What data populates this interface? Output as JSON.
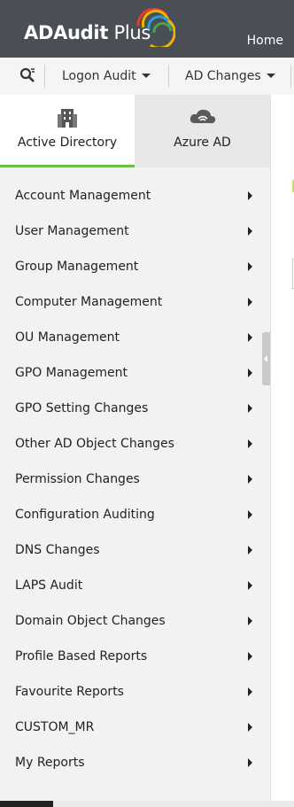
{
  "header": {
    "logo_text_bold": "ADAudit",
    "logo_text_light": "Plus",
    "home_label": "Home",
    "colors": {
      "background": "#4a4f55"
    }
  },
  "subnav": {
    "search_icon": "search-icon",
    "items": [
      {
        "label": "Logon Audit"
      },
      {
        "label": "AD Changes"
      }
    ]
  },
  "panel": {
    "tabs": [
      {
        "label": "Active Directory",
        "icon": "building-icon",
        "active": true
      },
      {
        "label": "Azure AD",
        "icon": "cloud-icon",
        "active": false
      }
    ],
    "menu": [
      {
        "label": "Account Management"
      },
      {
        "label": "User Management"
      },
      {
        "label": "Group Management"
      },
      {
        "label": "Computer Management"
      },
      {
        "label": "OU Management"
      },
      {
        "label": "GPO Management"
      },
      {
        "label": "GPO Setting Changes"
      },
      {
        "label": "Other AD Object Changes"
      },
      {
        "label": "Permission Changes"
      },
      {
        "label": "Configuration Auditing"
      },
      {
        "label": "DNS Changes"
      },
      {
        "label": "LAPS Audit"
      },
      {
        "label": "Domain Object Changes"
      },
      {
        "label": "Profile Based Reports"
      },
      {
        "label": "Favourite Reports"
      },
      {
        "label": "CUSTOM_MR"
      },
      {
        "label": "My Reports"
      }
    ],
    "accent_color": "#6cbd45"
  }
}
